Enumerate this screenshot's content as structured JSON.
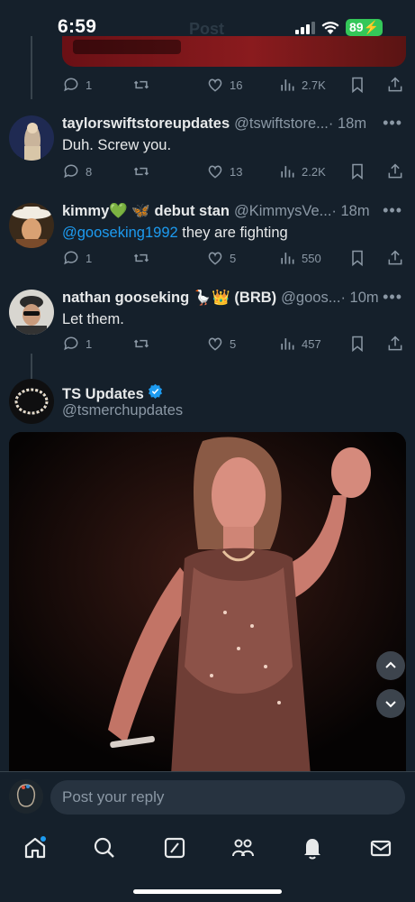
{
  "status": {
    "time": "6:59",
    "battery": "89"
  },
  "header": {
    "title": "Post"
  },
  "previous_tweet": {
    "actions": {
      "replies": "1",
      "likes": "16",
      "views": "2.7K"
    }
  },
  "replies": [
    {
      "name": "taylorswiftstoreupdates",
      "handle": "@tswiftstore...",
      "time": "· 18m",
      "text": "Duh. Screw you.",
      "actions": {
        "replies": "8",
        "likes": "13",
        "views": "2.2K"
      }
    },
    {
      "name": "kimmy💚 🦋 debut stan",
      "handle": "@KimmysVe...",
      "time": "· 18m",
      "mention": "@gooseking1992",
      "text": " they are fighting",
      "actions": {
        "replies": "1",
        "likes": "5",
        "views": "550"
      }
    },
    {
      "name": "nathan gooseking 🪿👑 (BRB)",
      "handle": "@goos...",
      "time": "· 10m",
      "text": "Let them.",
      "actions": {
        "replies": "1",
        "likes": "5",
        "views": "457"
      }
    }
  ],
  "quoted": {
    "name": "TS Updates",
    "handle": "@tsmerchupdates"
  },
  "reply_bar": {
    "placeholder": "Post your reply"
  },
  "colors": {
    "background": "#15202b",
    "accent": "#1d9bf0",
    "muted": "#8b98a5",
    "battery": "#34c759"
  },
  "tabs": [
    "home-icon",
    "search-icon",
    "grok-icon",
    "communities-icon",
    "notifications-icon",
    "messages-icon"
  ]
}
